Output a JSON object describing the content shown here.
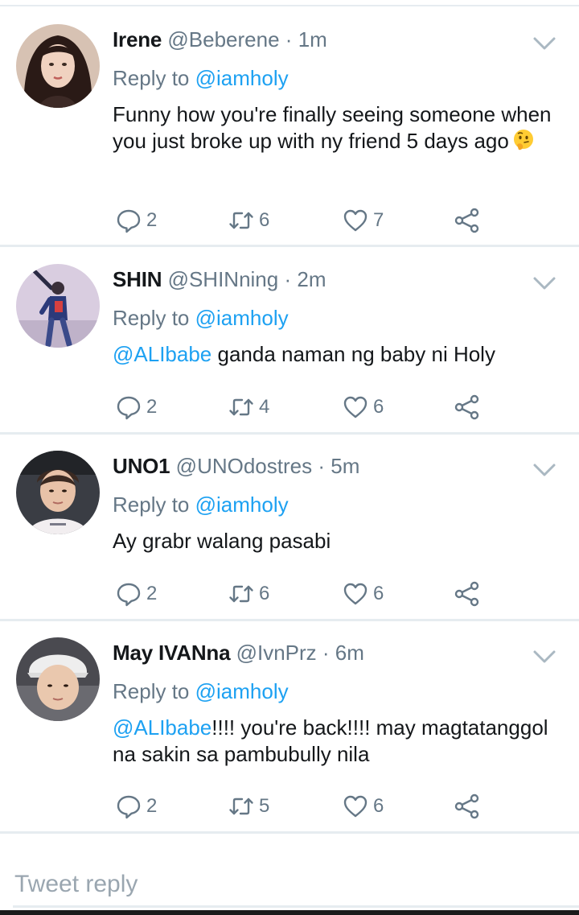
{
  "tweets": [
    {
      "name": "Irene",
      "handle": "@Beberene",
      "time": "1m",
      "reply_prefix": "Reply to",
      "reply_to": "@iamholy",
      "mention": "",
      "text": "Funny how you're finally seeing someone when you just broke up with ny friend 5 days ago",
      "emoji": "thinking-face",
      "replies": "2",
      "retweets": "6",
      "likes": "7"
    },
    {
      "name": "SHIN",
      "handle": "@SHINning",
      "time": "2m",
      "reply_prefix": "Reply to",
      "reply_to": "@iamholy",
      "mention": "@ALIbabe",
      "text": " ganda naman ng baby ni Holy",
      "replies": "2",
      "retweets": "4",
      "likes": "6"
    },
    {
      "name": "UNO1",
      "handle": "@UNOdostres",
      "time": "5m",
      "reply_prefix": "Reply to",
      "reply_to": "@iamholy",
      "mention": "",
      "text": "Ay grabr walang pasabi",
      "replies": "2",
      "retweets": "6",
      "likes": "6"
    },
    {
      "name": "May IVANna",
      "handle": "@IvnPrz",
      "time": "6m",
      "reply_prefix": "Reply to",
      "reply_to": "@iamholy",
      "mention": "@ALIbabe",
      "text": "!!!! you're back!!!! may magtatanggol na sakin sa pambubully nila",
      "replies": "2",
      "retweets": "5",
      "likes": "6"
    }
  ],
  "separator": "·",
  "compose": {
    "placeholder": "Tweet reply"
  },
  "colors": {
    "link": "#1da1f2",
    "muted": "#657786",
    "divider": "#e6ecf0"
  },
  "icons": [
    "reply-icon",
    "retweet-icon",
    "like-icon",
    "share-icon",
    "chevron-down-icon"
  ]
}
